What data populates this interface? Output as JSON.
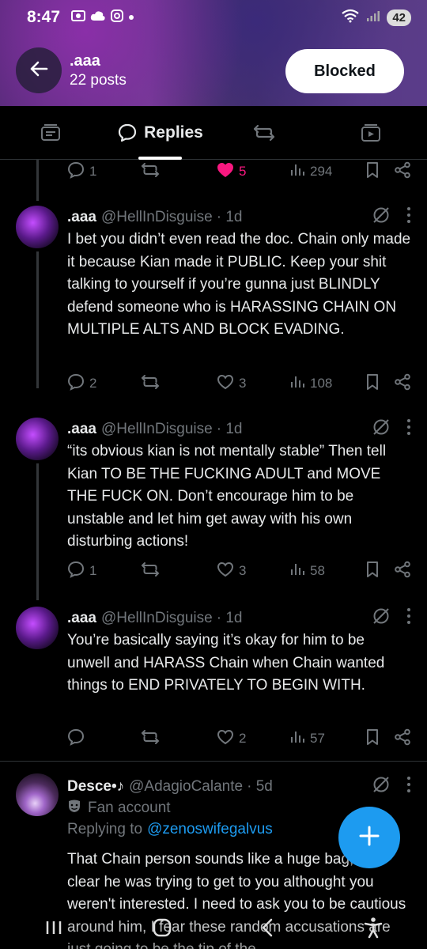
{
  "status_bar": {
    "time": "8:47",
    "battery": "42"
  },
  "profile": {
    "name": ".aaa",
    "posts": "22 posts",
    "relationship_button": "Blocked"
  },
  "tabs": [
    {
      "label": "",
      "icon": "posts-icon"
    },
    {
      "label": "Replies",
      "icon": "reply-bubble-icon"
    },
    {
      "label": "",
      "icon": "repost-icon"
    },
    {
      "label": "",
      "icon": "media-icon"
    }
  ],
  "top_actions": {
    "replies": "1",
    "reposts": "",
    "likes": "5",
    "views": "294"
  },
  "tweets": [
    {
      "name": ".aaa",
      "handle": "@HellInDisguise",
      "time": "· 1d",
      "text": "I bet you didn’t even read the doc. Chain only made it because Kian made it PUBLIC. Keep your shit talking to yourself if you’re gunna just BLINDLY defend someone who is HARASSING CHAIN ON MULTIPLE ALTS AND BLOCK EVADING.",
      "replies": "2",
      "reposts": "",
      "likes": "3",
      "views": "108"
    },
    {
      "name": ".aaa",
      "handle": "@HellInDisguise",
      "time": "· 1d",
      "text": "“its obvious kian is not mentally stable” Then tell Kian TO BE THE FUCKING ADULT and MOVE THE FUCK ON. Don’t encourage him to be unstable and let him get away with his own disturbing actions!",
      "replies": "1",
      "reposts": "",
      "likes": "3",
      "views": "58"
    },
    {
      "name": ".aaa",
      "handle": "@HellInDisguise",
      "time": "· 1d",
      "text": "You’re basically saying it’s okay for him to be unwell and HARASS Chain when Chain wanted things to END PRIVATELY TO BEGIN WITH.",
      "replies": "",
      "reposts": "",
      "likes": "2",
      "views": "57"
    },
    {
      "name": "Desce•♪",
      "handle": "@AdagioCalante",
      "time": "· 5d",
      "badge": "Fan account",
      "replying_prefix": "Replying to",
      "replying_to": "@zenoswifegalvus",
      "text": "That Chain person sounds like a huge bag, it's clear he was trying to get to you althought you weren't interested. I need to ask you to be cautious around him, I fear these random accusations are just going to be the tip of the"
    }
  ],
  "colors": {
    "accent": "#1d9bf0",
    "like": "#f91880",
    "muted": "#71767b",
    "text": "#e7e9ea"
  }
}
